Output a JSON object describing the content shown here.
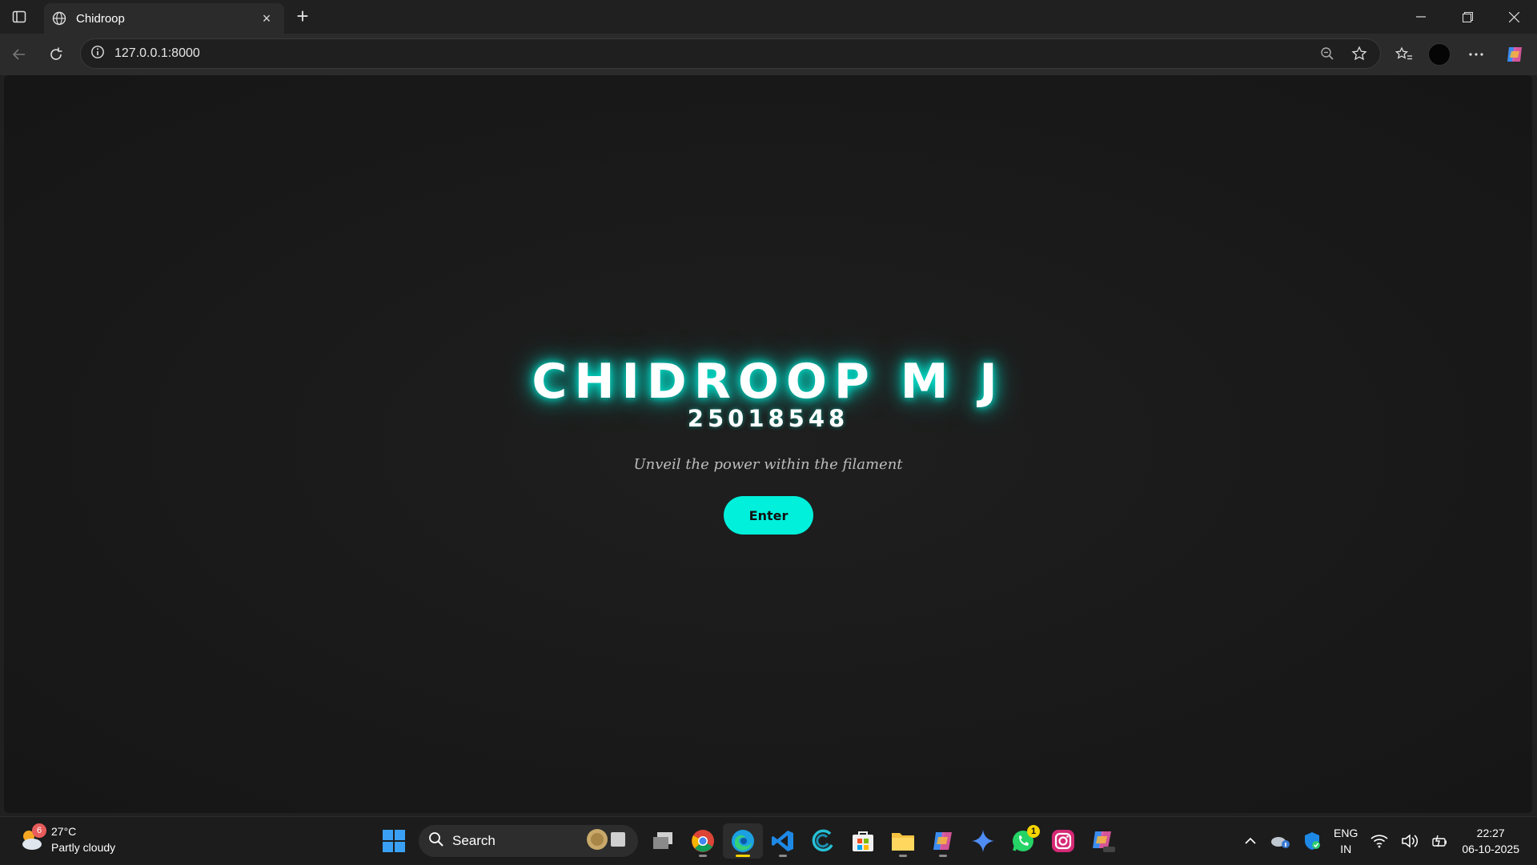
{
  "browser": {
    "tab_title": "Chidroop",
    "url": "127.0.0.1:8000"
  },
  "page": {
    "name": "CHIDROOP M J",
    "id": "25018548",
    "tagline": "Unveil the power within the filament",
    "enter_label": "Enter",
    "accent_color": "#00f0dc"
  },
  "taskbar": {
    "weather_badge": "6",
    "temperature": "27°C",
    "condition": "Partly cloudy",
    "search_label": "Search",
    "whatsapp_badge": "1",
    "lang_primary": "ENG",
    "lang_secondary": "IN",
    "time": "22:27",
    "date": "06-10-2025"
  }
}
